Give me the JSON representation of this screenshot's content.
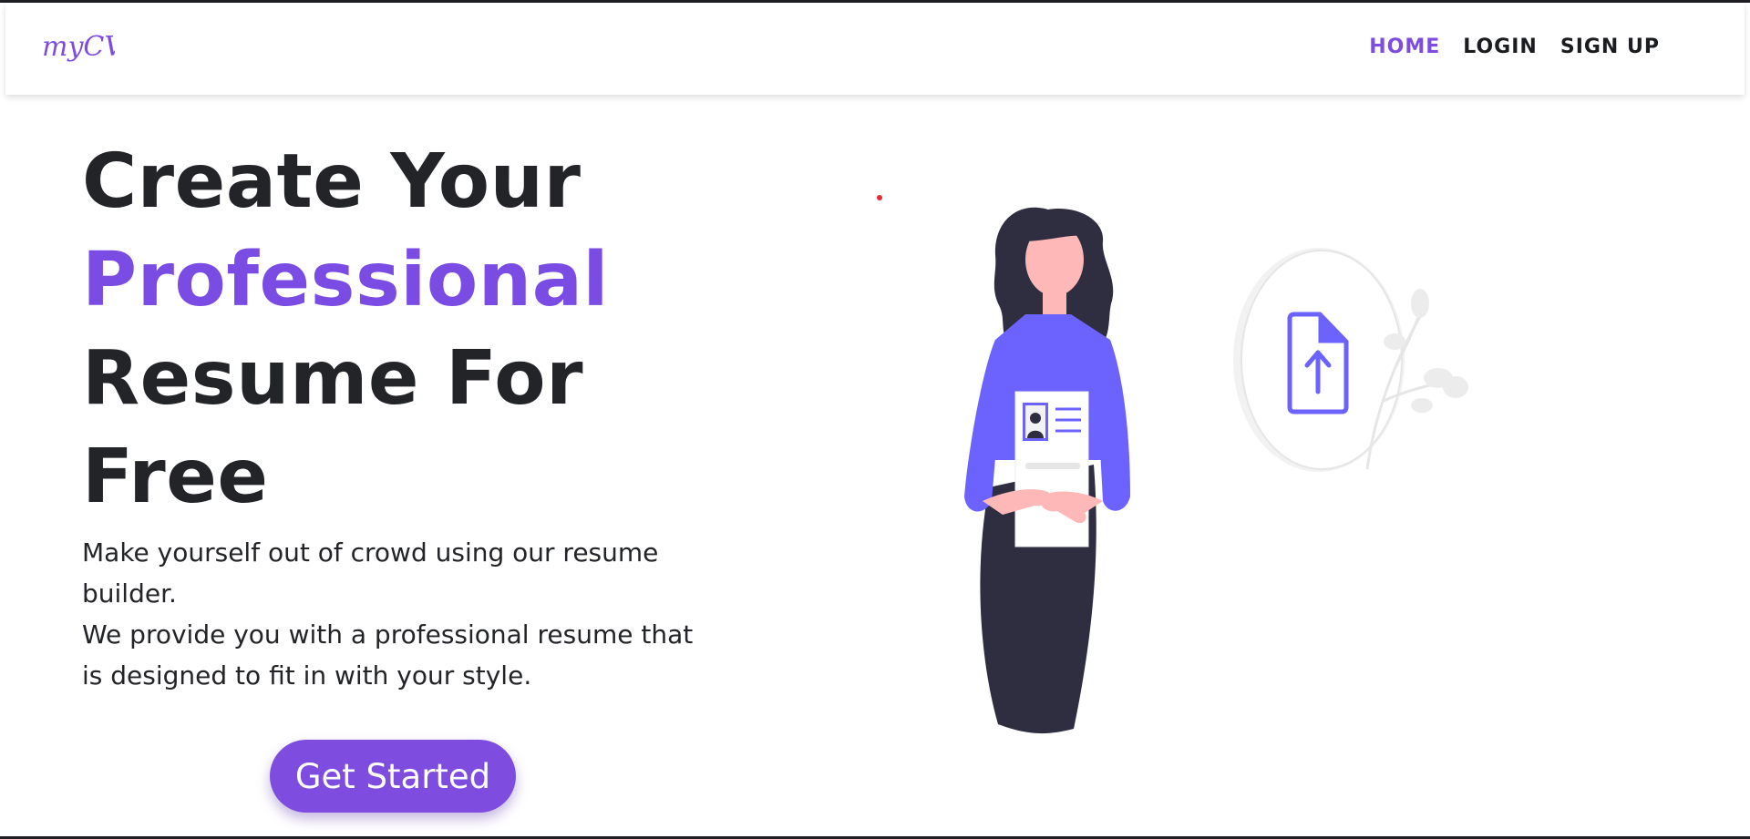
{
  "brand": {
    "logo_text": "myCV"
  },
  "nav": {
    "items": [
      {
        "label": "HOME",
        "active": true
      },
      {
        "label": "LOGIN",
        "active": false
      },
      {
        "label": "SIGN UP",
        "active": false
      }
    ]
  },
  "hero": {
    "title_line1": "Create Your",
    "title_accent": "Professional",
    "title_line3": "Resume For",
    "title_line4": "Free",
    "text_line1": "Make yourself out of crowd using our resume builder.",
    "text_line2": "We provide you with a professional resume that is designed to fit in with your style.",
    "cta_label": "Get Started"
  },
  "colors": {
    "accent": "#7e4de0",
    "illustration_purple": "#6c63ff",
    "text_dark": "#222428",
    "skirt": "#2f2e41",
    "skin": "#ffb8b8"
  },
  "icons": {
    "upload": "file-upload-icon"
  }
}
